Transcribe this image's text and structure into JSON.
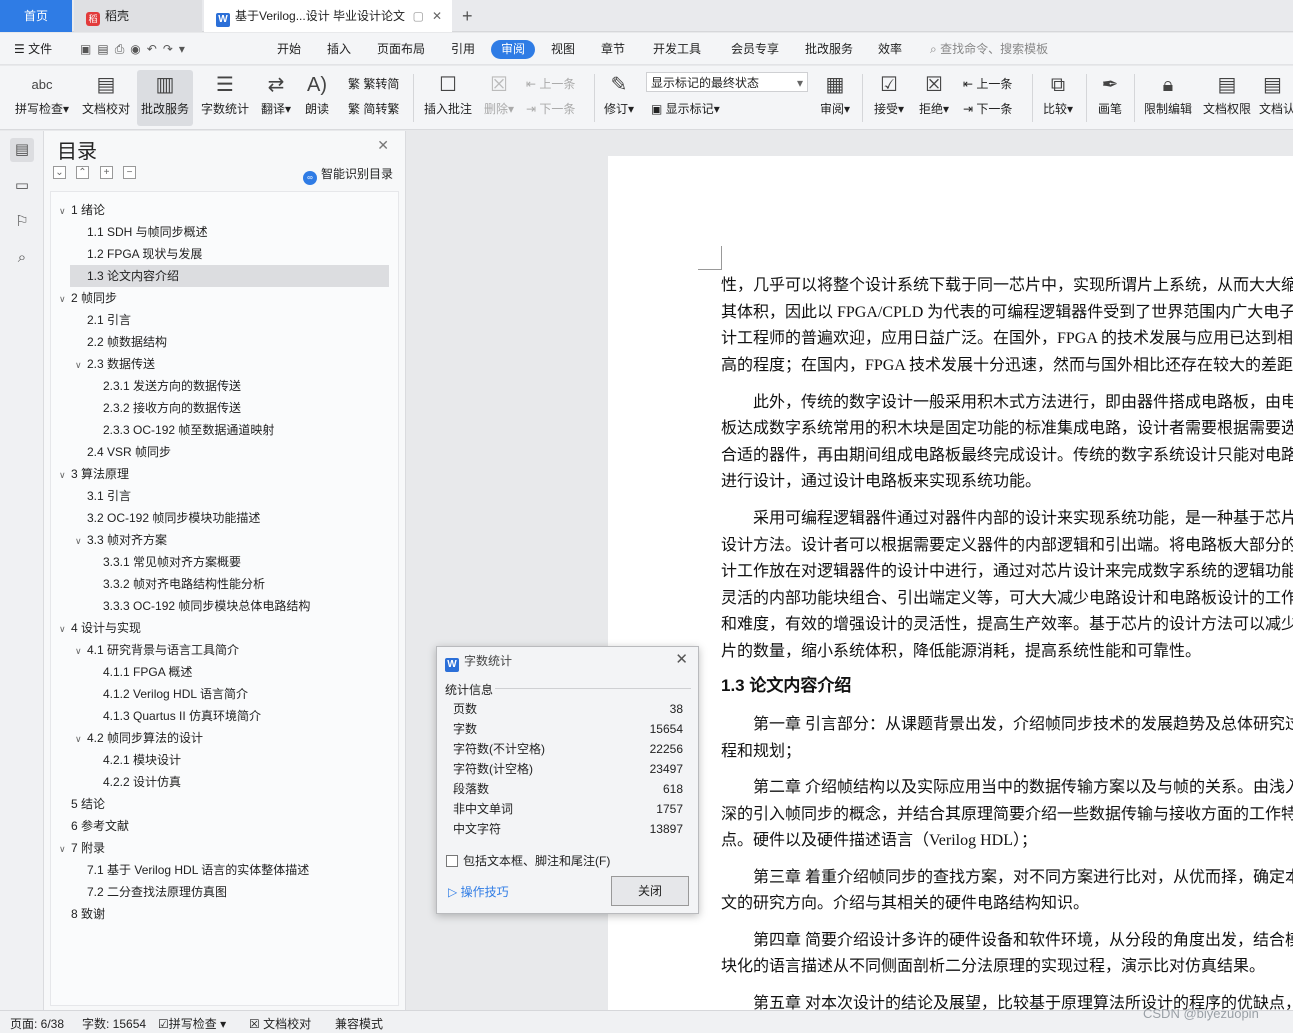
{
  "tabs": {
    "home": "首页",
    "daoke": "稻壳",
    "doc": "基于Verilog...设计 毕业设计论文"
  },
  "menu": {
    "file": "文件",
    "items": [
      "开始",
      "插入",
      "页面布局",
      "引用",
      "审阅",
      "视图",
      "章节",
      "开发工具",
      "会员专享",
      "批改服务",
      "效率"
    ],
    "search": "查找命令、搜索模板"
  },
  "ribbon": {
    "spellcheck": "拼写检查",
    "doccheck": "文档校对",
    "review_service": "批改服务",
    "wordcount": "字数统计",
    "translate": "翻译",
    "read": "朗读",
    "trad": "繁转简",
    "simp": "简转繁",
    "insert_comment": "插入批注",
    "delete": "删除",
    "prev": "上一条",
    "next": "下一条",
    "track": "修订",
    "markup_select": "显示标记的最终状态",
    "show_markup": "显示标记",
    "review_pane": "审阅",
    "accept": "接受",
    "reject": "拒绝",
    "prev2": "上一条",
    "next2": "下一条",
    "compare": "比较",
    "pen": "画笔",
    "restrict": "限制编辑",
    "perm": "文档权限",
    "docx": "文档认"
  },
  "toc": {
    "title": "目录",
    "smart": "智能识别目录",
    "items": [
      {
        "t": "1  绪论",
        "lv": 0,
        "arr": true
      },
      {
        "t": "1.1 SDH 与帧同步概述",
        "lv": 1
      },
      {
        "t": "1.2 FPGA 现状与发展",
        "lv": 1
      },
      {
        "t": "1.3  论文内容介绍",
        "lv": 1,
        "sel": true
      },
      {
        "t": "2  帧同步",
        "lv": 0,
        "arr": true
      },
      {
        "t": "2.1  引言",
        "lv": 1
      },
      {
        "t": "2.2  帧数据结构",
        "lv": 1
      },
      {
        "t": "2.3 数据传送",
        "lv": 1,
        "arr": true
      },
      {
        "t": "2.3.1  发送方向的数据传送",
        "lv": 2
      },
      {
        "t": "2.3.2  接收方向的数据传送",
        "lv": 2
      },
      {
        "t": "2.3.3 OC-192 帧至数据通道映射",
        "lv": 2
      },
      {
        "t": "2.4 VSR 帧同步",
        "lv": 1
      },
      {
        "t": "3  算法原理",
        "lv": 0,
        "arr": true
      },
      {
        "t": "3.1  引言",
        "lv": 1
      },
      {
        "t": "3.2 OC-192 帧同步模块功能描述",
        "lv": 1
      },
      {
        "t": "3.3  帧对齐方案",
        "lv": 1,
        "arr": true
      },
      {
        "t": "3.3.1  常见帧对齐方案概要",
        "lv": 2
      },
      {
        "t": "3.3.2  帧对齐电路结构性能分析",
        "lv": 2
      },
      {
        "t": "3.3.3 OC-192 帧同步模块总体电路结构",
        "lv": 2
      },
      {
        "t": "4  设计与实现",
        "lv": 0,
        "arr": true
      },
      {
        "t": "4.1 研究背景与语言工具简介",
        "lv": 1,
        "arr": true
      },
      {
        "t": "4.1.1 FPGA 概述",
        "lv": 2
      },
      {
        "t": "4.1.2 Verilog HDL 语言简介",
        "lv": 2
      },
      {
        "t": "4.1.3 Quartus II 仿真环境简介",
        "lv": 2
      },
      {
        "t": "4.2  帧同步算法的设计",
        "lv": 1,
        "arr": true
      },
      {
        "t": "4.2.1  模块设计",
        "lv": 2
      },
      {
        "t": "4.2.2  设计仿真",
        "lv": 2
      },
      {
        "t": "5  结论",
        "lv": 0
      },
      {
        "t": "6  参考文献",
        "lv": 0
      },
      {
        "t": "7  附录",
        "lv": 0,
        "arr": true
      },
      {
        "t": "7.1  基于 Verilog HDL 语言的实体整体描述",
        "lv": 1
      },
      {
        "t": "7.2  二分查找法原理仿真图",
        "lv": 1
      },
      {
        "t": "8  致谢",
        "lv": 0
      }
    ]
  },
  "doc": {
    "lines": [
      "性，几乎可以将整个设计系统下载于同一芯片中，实现所谓片上系统，从而大大缩小",
      "其体积，因此以 FPGA/CPLD 为代表的可编程逻辑器件受到了世界范围内广大电子设",
      "计工程师的普遍欢迎，应用日益广泛。在国外，FPGA 的技术发展与应用已达到相当",
      "高的程度；在国内，FPGA 技术发展十分迅速，然而与国外相比还存在较大的差距。",
      "　　此外，传统的数字设计一般采用积木式方法进行，即由器件搭成电路板，由电路",
      "板达成数字系统常用的积木块是固定功能的标准集成电路，设计者需要根据需要选择",
      "合适的器件，再由期间组成电路板最终完成设计。传统的数字系统设计只能对电路板",
      "进行设计，通过设计电路板来实现系统功能。",
      "　　采用可编程逻辑器件通过对器件内部的设计来实现系统功能，是一种基于芯片的",
      "设计方法。设计者可以根据需要定义器件的内部逻辑和引出端。将电路板大部分的设",
      "计工作放在对逻辑器件的设计中进行，通过对芯片设计来完成数字系统的逻辑功能。",
      "灵活的内部功能块组合、引出端定义等，可大大减少电路设计和电路板设计的工作量",
      "和难度，有效的增强设计的灵活性，提高生产效率。基于芯片的设计方法可以减少芯",
      "片的数量，缩小系统体积，降低能源消耗，提高系统性能和可靠性。"
    ],
    "heading": "1.3  论文内容介绍",
    "lines2": [
      "　　第一章  引言部分：从课题背景出发，介绍帧同步技术的发展趋势及总体研究过",
      "程和规划；",
      "　　第二章  介绍帧结构以及实际应用当中的数据传输方案以及与帧的关系。由浅入",
      "深的引入帧同步的概念，并结合其原理简要介绍一些数据传输与接收方面的工作特",
      "点。硬件以及硬件描述语言（Verilog HDL）；",
      "　　第三章  着重介绍帧同步的查找方案，对不同方案进行比对，从优而择，确定本",
      "文的研究方向。介绍与其相关的硬件电路结构知识。",
      "　　第四章  简要介绍设计多许的硬件设备和软件环境，从分段的角度出发，结合模",
      "块化的语言描述从不同侧面剖析二分法原理的实现过程，演示比对仿真结果。",
      "　　第五章  对本次设计的结论及展望，比较基于原理算法所设计的程序的优缺点，"
    ]
  },
  "dialog": {
    "title": "字数统计",
    "group": "统计信息",
    "rows": [
      {
        "k": "页数",
        "v": "38"
      },
      {
        "k": "字数",
        "v": "15654"
      },
      {
        "k": "字符数(不计空格)",
        "v": "22256"
      },
      {
        "k": "字符数(计空格)",
        "v": "23497"
      },
      {
        "k": "段落数",
        "v": "618"
      },
      {
        "k": "非中文单词",
        "v": "1757"
      },
      {
        "k": "中文字符",
        "v": "13897"
      }
    ],
    "checkbox": "包括文本框、脚注和尾注(F)",
    "tips": "操作技巧",
    "close": "关闭"
  },
  "status": {
    "page": "页面: 6/38",
    "words": "字数: 15654",
    "spell": "拼写检查",
    "doccheck": "文档校对",
    "compat": "兼容模式"
  },
  "watermark": "CSDN @biyezuopin"
}
